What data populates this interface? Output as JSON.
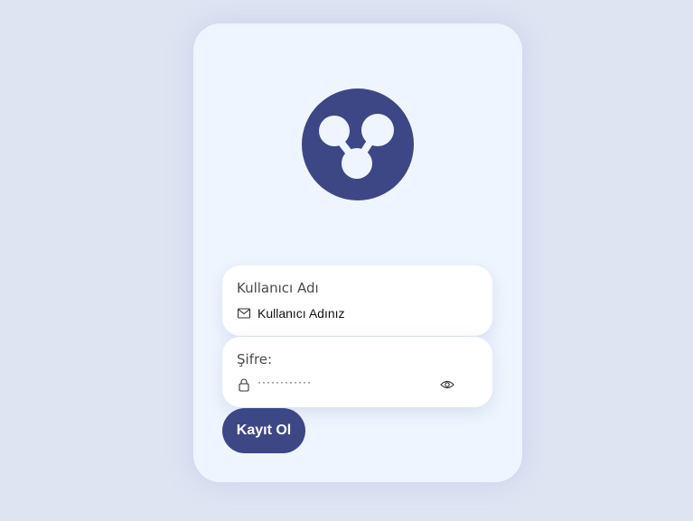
{
  "form": {
    "logo_icon": "network-nodes-icon",
    "username": {
      "label": "Kullanıcı Adı",
      "icon": "mail-icon",
      "placeholder": "Kullanıcı Adınız"
    },
    "password": {
      "label": "Şifre:",
      "icon": "lock-icon",
      "masked_value": "············",
      "toggle_icon": "eye-icon"
    },
    "submit_label": "Kayıt Ol"
  },
  "colors": {
    "background": "#dfe4f3",
    "card": "#eff5fe",
    "accent": "#3d4785",
    "field": "#ffffff"
  }
}
